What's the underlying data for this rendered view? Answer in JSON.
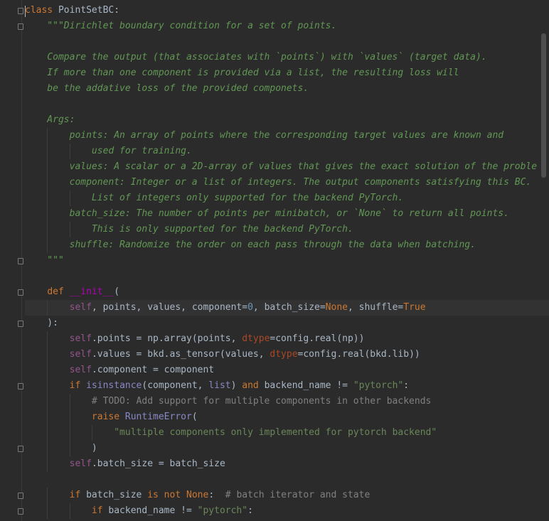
{
  "lines": [
    [
      {
        "t": "class",
        "c": "kw"
      },
      {
        "t": " PointSetBC:",
        "c": ""
      }
    ],
    [
      {
        "t": "    \"\"\"Dirichlet boundary condition for a set of points.",
        "c": "doc"
      }
    ],
    [],
    [
      {
        "t": "    Compare the output (that associates with `points`) with `values` (target data).",
        "c": "doc"
      }
    ],
    [
      {
        "t": "    If more than one component is provided via a list, the resulting loss will",
        "c": "doc"
      }
    ],
    [
      {
        "t": "    be the addative loss of the provided componets.",
        "c": "doc"
      }
    ],
    [],
    [
      {
        "t": "    Args:",
        "c": "doc"
      }
    ],
    [
      {
        "t": "        points: An array of points where the corresponding target values are known and",
        "c": "doc"
      }
    ],
    [
      {
        "t": "            used for training.",
        "c": "doc"
      }
    ],
    [
      {
        "t": "        values: A scalar or a 2D-array of values that gives the exact solution of the proble",
        "c": "doc"
      }
    ],
    [
      {
        "t": "        component: Integer or a list of integers. The output components satisfying this BC.",
        "c": "doc"
      }
    ],
    [
      {
        "t": "            List of integers only supported for the backend PyTorch.",
        "c": "doc"
      }
    ],
    [
      {
        "t": "        batch_size: The number of points per minibatch, or `None` to return all points.",
        "c": "doc"
      }
    ],
    [
      {
        "t": "            This is only supported for the backend PyTorch.",
        "c": "doc"
      }
    ],
    [
      {
        "t": "        shuffle: Randomize the order on each pass through the data when batching.",
        "c": "doc"
      }
    ],
    [
      {
        "t": "    \"\"\"",
        "c": "doc"
      }
    ],
    [],
    [
      {
        "t": "    ",
        "c": ""
      },
      {
        "t": "def",
        "c": "kw"
      },
      {
        "t": " ",
        "c": ""
      },
      {
        "t": "__init__",
        "c": "magic"
      },
      {
        "t": "(",
        "c": ""
      }
    ],
    [
      {
        "t": "        ",
        "c": ""
      },
      {
        "t": "self",
        "c": "self"
      },
      {
        "t": ", points, values, component=",
        "c": ""
      },
      {
        "t": "0",
        "c": "num"
      },
      {
        "t": ", batch_size=",
        "c": ""
      },
      {
        "t": "None",
        "c": "kw"
      },
      {
        "t": ", shuffle=",
        "c": ""
      },
      {
        "t": "True",
        "c": "kw"
      }
    ],
    [
      {
        "t": "    ):",
        "c": ""
      }
    ],
    [
      {
        "t": "        ",
        "c": ""
      },
      {
        "t": "self",
        "c": "self"
      },
      {
        "t": ".points = np.array(points, ",
        "c": ""
      },
      {
        "t": "dtype",
        "c": "param"
      },
      {
        "t": "=config.real(np))",
        "c": ""
      }
    ],
    [
      {
        "t": "        ",
        "c": ""
      },
      {
        "t": "self",
        "c": "self"
      },
      {
        "t": ".values = bkd.as_tensor(values, ",
        "c": ""
      },
      {
        "t": "dtype",
        "c": "param"
      },
      {
        "t": "=config.real(bkd.lib))",
        "c": ""
      }
    ],
    [
      {
        "t": "        ",
        "c": ""
      },
      {
        "t": "self",
        "c": "self"
      },
      {
        "t": ".component = component",
        "c": ""
      }
    ],
    [
      {
        "t": "        ",
        "c": ""
      },
      {
        "t": "if",
        "c": "kw"
      },
      {
        "t": " ",
        "c": ""
      },
      {
        "t": "isinstance",
        "c": "builtin"
      },
      {
        "t": "(component, ",
        "c": ""
      },
      {
        "t": "list",
        "c": "builtin"
      },
      {
        "t": ") ",
        "c": ""
      },
      {
        "t": "and",
        "c": "kw"
      },
      {
        "t": " backend_name != ",
        "c": ""
      },
      {
        "t": "\"pytorch\"",
        "c": "str"
      },
      {
        "t": ":",
        "c": ""
      }
    ],
    [
      {
        "t": "            ",
        "c": ""
      },
      {
        "t": "# TODO: Add support for multiple components in other backends",
        "c": "cmt"
      }
    ],
    [
      {
        "t": "            ",
        "c": ""
      },
      {
        "t": "raise",
        "c": "kw"
      },
      {
        "t": " ",
        "c": ""
      },
      {
        "t": "RuntimeError",
        "c": "builtin"
      },
      {
        "t": "(",
        "c": ""
      }
    ],
    [
      {
        "t": "                ",
        "c": ""
      },
      {
        "t": "\"multiple components only implemented for pytorch backend\"",
        "c": "str"
      }
    ],
    [
      {
        "t": "            )",
        "c": ""
      }
    ],
    [
      {
        "t": "        ",
        "c": ""
      },
      {
        "t": "self",
        "c": "self"
      },
      {
        "t": ".batch_size = batch_size",
        "c": ""
      }
    ],
    [],
    [
      {
        "t": "        ",
        "c": ""
      },
      {
        "t": "if",
        "c": "kw"
      },
      {
        "t": " batch_size ",
        "c": ""
      },
      {
        "t": "is not",
        "c": "kw"
      },
      {
        "t": " ",
        "c": ""
      },
      {
        "t": "None",
        "c": "kw"
      },
      {
        "t": ":  ",
        "c": ""
      },
      {
        "t": "# batch iterator and state",
        "c": "cmt"
      }
    ],
    [
      {
        "t": "            ",
        "c": ""
      },
      {
        "t": "if",
        "c": "kw"
      },
      {
        "t": " backend_name != ",
        "c": ""
      },
      {
        "t": "\"pytorch\"",
        "c": "str"
      },
      {
        "t": ":",
        "c": ""
      }
    ]
  ],
  "current_line": 19,
  "fold_markers": [
    0,
    1,
    16,
    18,
    20,
    24,
    28,
    31,
    32
  ]
}
